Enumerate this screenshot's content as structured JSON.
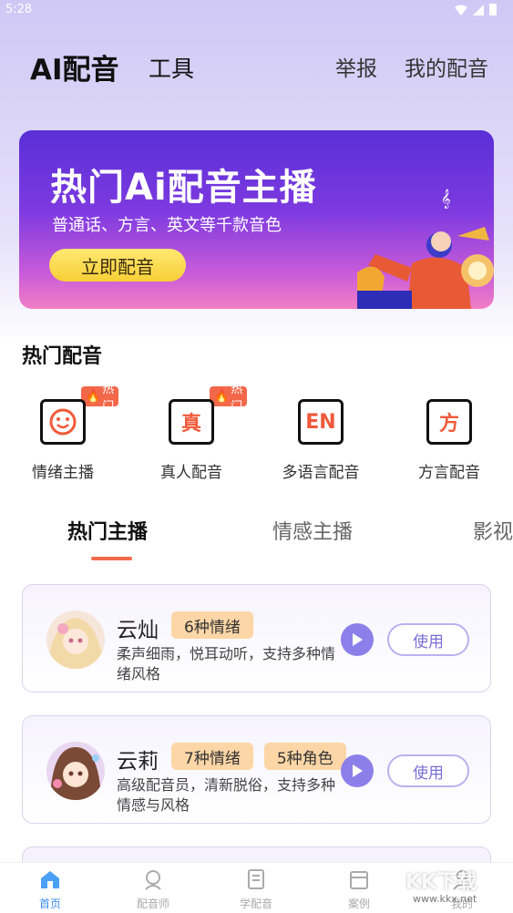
{
  "status_bar": {
    "time": "5:28"
  },
  "header": {
    "app_title": "AI配音",
    "tools_tab": "工具",
    "report_link": "举报",
    "my_dub_link": "我的配音"
  },
  "banner": {
    "title": "热门Ai配音主播",
    "subtitle": "普通话、方言、英文等千款音色",
    "button": "立即配音"
  },
  "hot_section": {
    "title": "热门配音",
    "badge_text": "热门",
    "items": [
      {
        "label": "情绪主播",
        "icon": "smiley-icon",
        "glyph": "",
        "hot": true
      },
      {
        "label": "真人配音",
        "icon": "zhen-icon",
        "glyph": "真",
        "hot": true
      },
      {
        "label": "多语言配音",
        "icon": "en-icon",
        "glyph": "EN",
        "hot": false
      },
      {
        "label": "方言配音",
        "icon": "fang-icon",
        "glyph": "方",
        "hot": false
      }
    ]
  },
  "tabs": [
    "热门主播",
    "情感主播",
    "影视"
  ],
  "anchors": [
    {
      "name": "云灿",
      "tags": [
        "6种情绪"
      ],
      "desc": "柔声细雨，悦耳动听，支持多种情绪风格",
      "use": "使用"
    },
    {
      "name": "云莉",
      "tags": [
        "7种情绪",
        "5种角色"
      ],
      "desc": "高级配音员，清新脱俗，支持多种情感与风格",
      "use": "使用"
    }
  ],
  "bottom_nav": [
    {
      "label": "首页",
      "icon": "home-icon",
      "active": true
    },
    {
      "label": "配音师",
      "icon": "dubber-icon",
      "active": false
    },
    {
      "label": "学配音",
      "icon": "book-icon",
      "active": false
    },
    {
      "label": "案例",
      "icon": "case-icon",
      "active": false
    },
    {
      "label": "我的",
      "icon": "profile-icon",
      "active": false
    }
  ],
  "watermark": {
    "text": "KK下载",
    "url": "www.kkx.net"
  },
  "colors": {
    "accent": "#f16a4d",
    "primary_purple": "#8c7fea",
    "tag_bg": "#fcd6a6",
    "nav_active": "#3b8df0"
  }
}
